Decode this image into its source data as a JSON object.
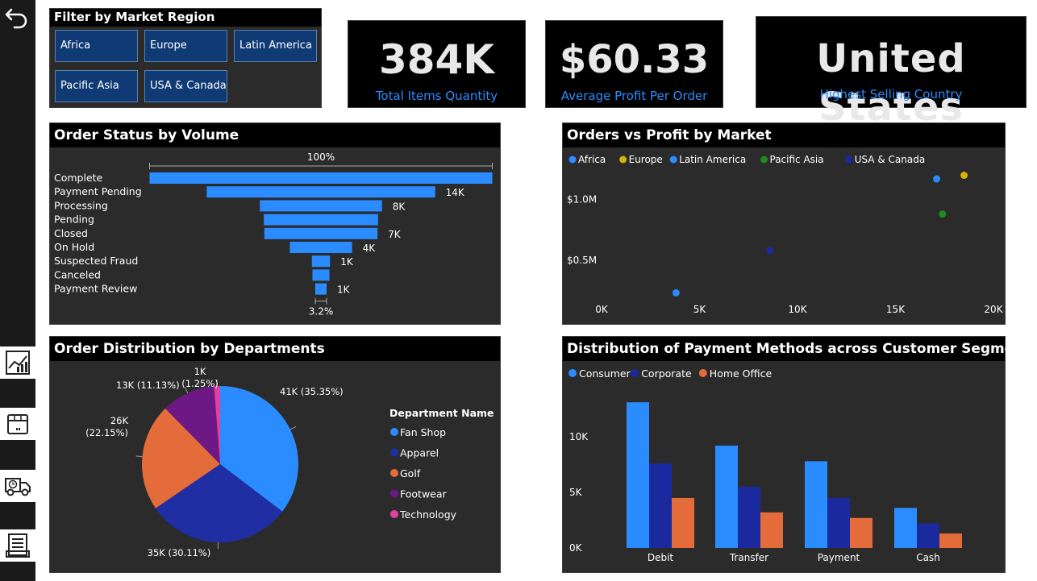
{
  "sidebar": {
    "back_icon": "undo-arrow-icon",
    "nav_icons": [
      "chart-report-icon",
      "package-box-icon",
      "delivery-truck-icon",
      "document-list-icon"
    ]
  },
  "filter": {
    "title": "Filter by Market Region",
    "options": [
      "Africa",
      "Europe",
      "Latin America",
      "Pacific Asia",
      "USA & Canada"
    ]
  },
  "kpis": [
    {
      "value": "384K",
      "label": "Total Items Quantity"
    },
    {
      "value": "$60.33",
      "label": "Average Profit Per Order"
    },
    {
      "value": "United States",
      "label": "Highest Selling Country"
    }
  ],
  "colors": {
    "panel_bg": "#2b2b2b",
    "title_bg": "#000000",
    "accent_blue": "#2b8cff",
    "slicer_bg": "#0f3a73"
  },
  "funnel": {
    "title": "Order Status by Volume",
    "top_pct": "100%",
    "bottom_pct": "3.2%"
  },
  "scatter": {
    "title": "Orders vs Profit by Market"
  },
  "pie": {
    "title": "Order Distribution by Departments",
    "legend_title": "Department Name"
  },
  "bars": {
    "title": "Distribution of Payment Methods across Customer Segments"
  },
  "chart_data": [
    {
      "type": "bar",
      "orientation": "funnel",
      "title": "Order Status by Volume",
      "categories": [
        "Complete",
        "Payment Pending",
        "Processing",
        "Pending",
        "Closed",
        "On Hold",
        "Suspected Fraud",
        "Canceled",
        "Payment Review"
      ],
      "values": [
        30.3,
        20.2,
        10.8,
        10.1,
        10.0,
        5.5,
        1.6,
        1.5,
        1.0
      ],
      "value_unit": "thousand orders",
      "data_labels": [
        "",
        "14K",
        "8K",
        "",
        "7K",
        "4K",
        "1K",
        "",
        "1K"
      ],
      "top_label": "100%",
      "bottom_label": "3.2%",
      "color": "#2b8cff"
    },
    {
      "type": "scatter",
      "title": "Orders vs Profit by Market",
      "xlim": [
        0,
        20000
      ],
      "ylim": [
        0,
        1250000
      ],
      "x_ticks": [
        "0K",
        "5K",
        "10K",
        "15K",
        "20K"
      ],
      "y_ticks": [
        "$0.5M",
        "$1.0M"
      ],
      "legend_position": "top-left",
      "series": [
        {
          "name": "Africa",
          "color": "#2b8cff",
          "x": [
            3800
          ],
          "y": [
            230000
          ]
        },
        {
          "name": "Europe",
          "color": "#d4b20a",
          "x": [
            18500
          ],
          "y": [
            1200000
          ]
        },
        {
          "name": "Latin America",
          "color": "#2b8cff",
          "x": [
            17100
          ],
          "y": [
            1170000
          ]
        },
        {
          "name": "Pacific Asia",
          "color": "#1f8a1f",
          "x": [
            17400
          ],
          "y": [
            880000
          ]
        },
        {
          "name": "USA & Canada",
          "color": "#1a2a9e",
          "x": [
            8600
          ],
          "y": [
            580000
          ]
        }
      ]
    },
    {
      "type": "pie",
      "title": "Order Distribution by Departments",
      "legend_title": "Department Name",
      "legend_position": "right",
      "categories": [
        "Fan Shop",
        "Apparel",
        "Golf",
        "Footwear",
        "Technology"
      ],
      "values": [
        35.35,
        30.11,
        22.15,
        11.13,
        1.25
      ],
      "colors": [
        "#2b8cff",
        "#1f2fa3",
        "#e46c3a",
        "#6e1885",
        "#e040a0"
      ],
      "data_labels": [
        "41K (35.35%)",
        "35K (30.11%)",
        "26K\n(22.15%)",
        "13K (11.13%)",
        "1K\n(1.25%)"
      ]
    },
    {
      "type": "bar",
      "title": "Distribution of Payment Methods across Customer Segments",
      "categories": [
        "Debit",
        "Transfer",
        "Payment",
        "Cash"
      ],
      "ylim": [
        0,
        14000
      ],
      "y_ticks": [
        "0K",
        "5K",
        "10K"
      ],
      "legend_position": "top-left",
      "series": [
        {
          "name": "Consumer",
          "color": "#2b8cff",
          "values": [
            13100,
            9200,
            7800,
            3600
          ]
        },
        {
          "name": "Corporate",
          "color": "#1a2a9e",
          "values": [
            7600,
            5500,
            4500,
            2200
          ]
        },
        {
          "name": "Home Office",
          "color": "#e46c3a",
          "values": [
            4500,
            3200,
            2700,
            1300
          ]
        }
      ]
    }
  ]
}
